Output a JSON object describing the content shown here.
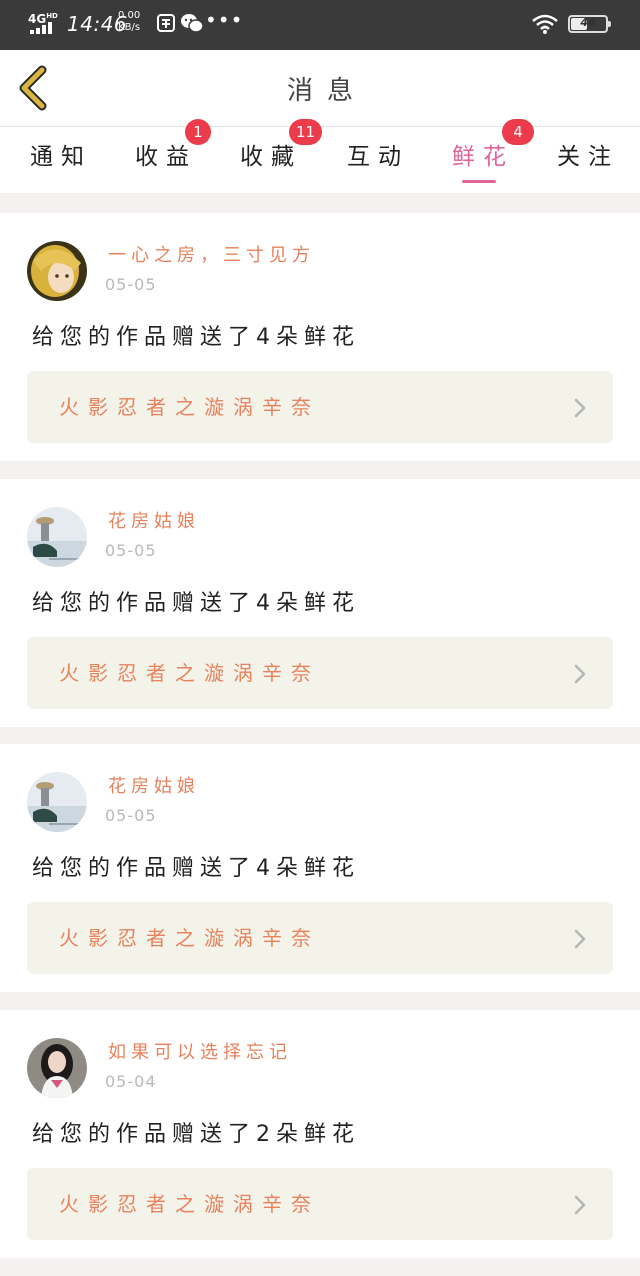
{
  "status_bar": {
    "network": "4G",
    "network_sup": "HD",
    "time": "14:46",
    "speed_value": "0.00",
    "speed_unit": "KB/s",
    "more": "•••",
    "battery": "44",
    "battery_level": 0.44
  },
  "header": {
    "back_icon": "chevron-left-icon",
    "title": "消息"
  },
  "tabs": [
    {
      "label": "通知",
      "badge": ""
    },
    {
      "label": "收益",
      "badge": "1"
    },
    {
      "label": "收藏",
      "badge": "11"
    },
    {
      "label": "互动",
      "badge": ""
    },
    {
      "label": "鲜花",
      "badge": "4",
      "active": true
    },
    {
      "label": "关注",
      "badge": ""
    }
  ],
  "messages": [
    {
      "name": "一心之房，三寸见方",
      "date": "05-05",
      "text": "给您的作品赠送了4朵鲜花",
      "work": "火影忍者之漩涡辛奈"
    },
    {
      "name": "花房姑娘",
      "date": "05-05",
      "text": "给您的作品赠送了4朵鲜花",
      "work": "火影忍者之漩涡辛奈"
    },
    {
      "name": "花房姑娘",
      "date": "05-05",
      "text": "给您的作品赠送了4朵鲜花",
      "work": "火影忍者之漩涡辛奈"
    },
    {
      "name": "如果可以选择忘记",
      "date": "05-04",
      "text": "给您的作品赠送了2朵鲜花",
      "work": "火影忍者之漩涡辛奈"
    }
  ],
  "colors": {
    "accent_pink": "#e0639a",
    "name_orange": "#e8825d",
    "badge_red": "#ec3b4a",
    "back_gold": "#c9a227",
    "status_bar": "#3a3a3a"
  }
}
